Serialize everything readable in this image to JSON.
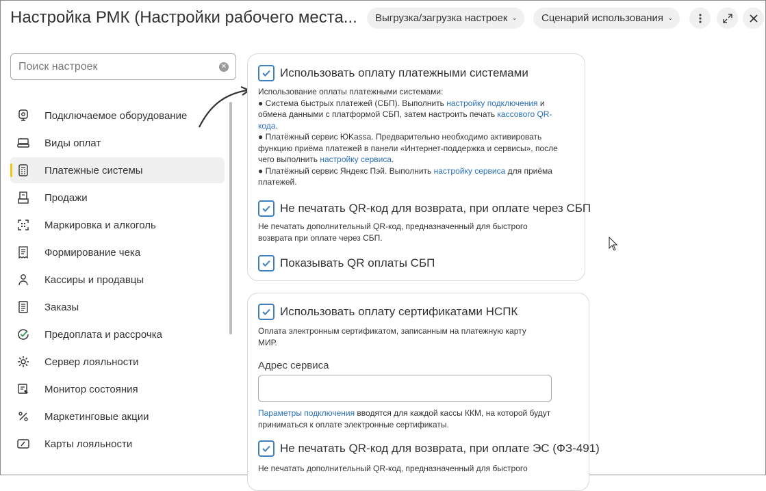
{
  "header": {
    "title": "Настройка РМК (Настройки рабочего места...",
    "export_label": "Выгрузка/загрузка настроек",
    "scenario_label": "Сценарий использования"
  },
  "search": {
    "placeholder": "Поиск настроек"
  },
  "sidebar": {
    "items": [
      {
        "label": "Подключаемое оборудование",
        "icon": "equipment-icon"
      },
      {
        "label": "Виды оплат",
        "icon": "payment-types-icon"
      },
      {
        "label": "Платежные системы",
        "icon": "payment-systems-icon",
        "active": true
      },
      {
        "label": "Продажи",
        "icon": "sales-icon"
      },
      {
        "label": "Маркировка и алкоголь",
        "icon": "marking-icon"
      },
      {
        "label": "Формирование чека",
        "icon": "receipt-icon"
      },
      {
        "label": "Кассиры и продавцы",
        "icon": "cashiers-icon"
      },
      {
        "label": "Заказы",
        "icon": "orders-icon"
      },
      {
        "label": "Предоплата и рассрочка",
        "icon": "prepayment-icon"
      },
      {
        "label": "Сервер лояльности",
        "icon": "loyalty-server-icon"
      },
      {
        "label": "Монитор состояния",
        "icon": "monitor-icon"
      },
      {
        "label": "Маркетинговые акции",
        "icon": "percent-icon"
      },
      {
        "label": "Карты лояльности",
        "icon": "loyalty-card-icon"
      }
    ]
  },
  "card1": {
    "payment_systems": {
      "label": "Использовать оплату платежными системами",
      "checked": true,
      "desc_intro": "Использование оплаты платежными системами:",
      "sbp_a": "● Система быстрых платежей (СБП). Выполнить ",
      "sbp_link1": "настройку подключения",
      "sbp_b": " и обмена данными с платформой СБП, затем настроить печать ",
      "sbp_link2": "кассового QR-кода",
      "sbp_c": ".",
      "yk_a": "● Платёжный сервис ЮKassa. Предварительно необходимо активировать функцию приёма платежей в панели «Интернет-поддержка и сервисы», после чего выполнить ",
      "yk_link": "настройку сервиса",
      "yk_b": ".",
      "yp_a": "● Платёжный сервис Яндекс Пэй. Выполнить ",
      "yp_link": "настройку сервиса",
      "yp_b": " для приёма платежей."
    },
    "no_qr_return": {
      "label": "Не печатать QR-код для возврата, при оплате через СБП",
      "checked": true,
      "desc": "Не печатать дополнительный QR-код, предназначенный для быстрого возврата при оплате через СБП."
    },
    "show_qr": {
      "label": "Показывать QR оплаты СБП",
      "checked": true
    }
  },
  "card2": {
    "nspk": {
      "label": "Использовать оплату сертификатами НСПК",
      "checked": true,
      "desc": "Оплата электронным сертификатом, записанным на платежную карту МИР."
    },
    "service_address": {
      "label": "Адрес сервиса",
      "value": ""
    },
    "params_link": "Параметры подключения",
    "params_text": " вводятся для каждой кассы ККМ, на которой будут приниматься к оплате электронные сертификаты.",
    "no_qr_es": {
      "label": "Не печатать QR-код для возврата, при оплате ЭС (ФЗ-491)",
      "checked": true,
      "desc": "Не печатать дополнительный QR-код, предназначенный для быстрого"
    }
  },
  "colors": {
    "accent": "#3f7fbf",
    "link": "#2a6fb7",
    "active_marker": "#f1c40f"
  }
}
